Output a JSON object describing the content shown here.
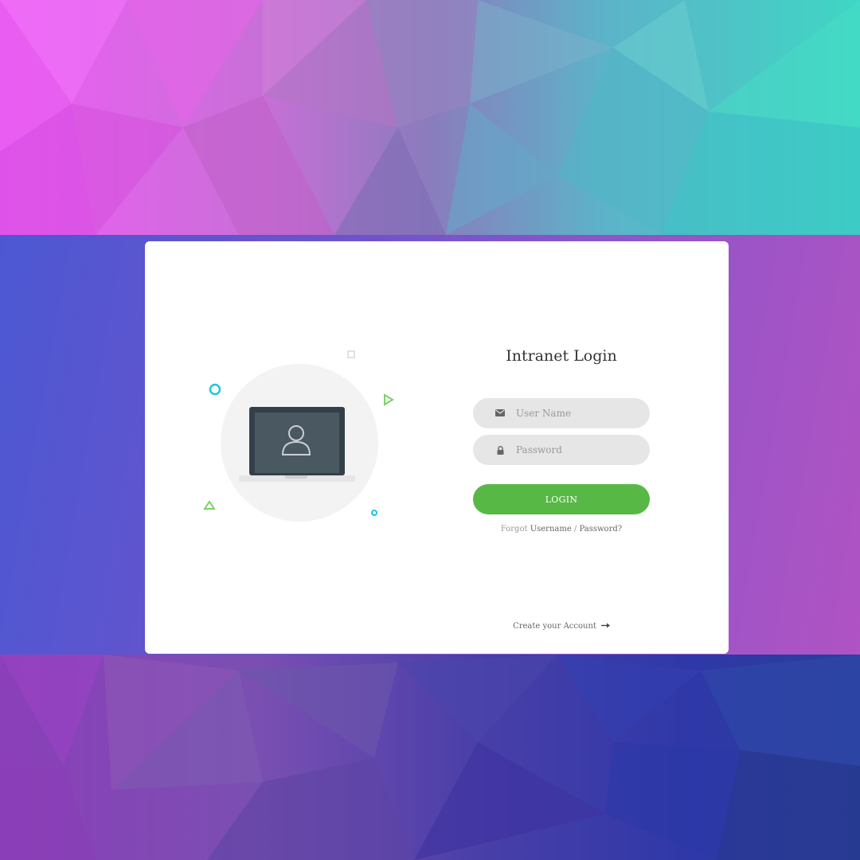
{
  "login": {
    "title": "Intranet Login",
    "username_placeholder": "User Name",
    "password_placeholder": "Password",
    "login_label": "LOGIN",
    "forgot_prefix": "Forgot",
    "forgot_username": "Username",
    "forgot_separator": " / ",
    "forgot_password": "Password?",
    "create_account": "Create your Account"
  },
  "icons": {
    "username": "envelope-icon",
    "password": "lock-icon",
    "create": "arrow-right-icon",
    "illustration": "laptop-user-icon"
  },
  "colors": {
    "login_button": "#57b846",
    "field_bg": "#e6e6e6",
    "accent_cyan": "#1fc6e0",
    "accent_green": "#7bd16a"
  }
}
